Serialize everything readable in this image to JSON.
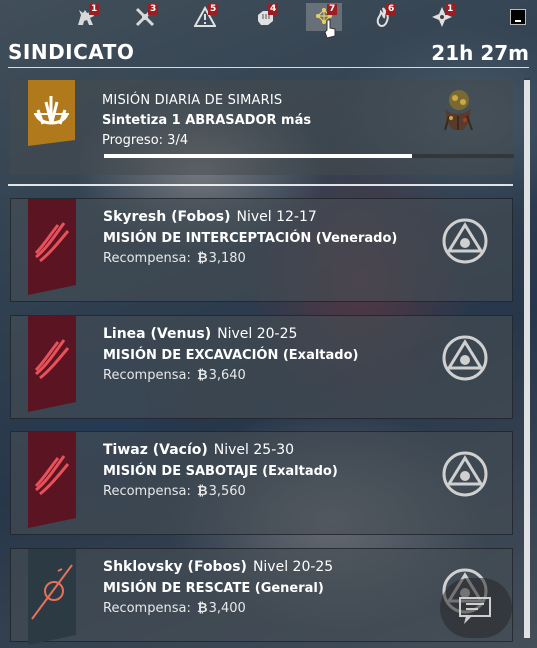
{
  "topbar": {
    "tabs": [
      {
        "icon": "wolf-icon",
        "badge": "1"
      },
      {
        "icon": "crossed-swords-icon",
        "badge": "3"
      },
      {
        "icon": "warning-icon",
        "badge": "5"
      },
      {
        "icon": "fist-icon",
        "badge": "4"
      },
      {
        "icon": "syndicate-tree-icon",
        "badge": "7",
        "active": true
      },
      {
        "icon": "flame-icon",
        "badge": "6"
      },
      {
        "icon": "shuriken-icon",
        "badge": "1"
      }
    ]
  },
  "header": {
    "title": "SINDICATO",
    "time": "21h 27m"
  },
  "daily": {
    "title": "MISIÓN DIARIA DE SIMARIS",
    "description": "Sintetiza 1 ABRASADOR más",
    "progress_text": "Progreso: 3/4",
    "progress_value": 0.75,
    "emblem_color": "#b07a1c",
    "emblem_icon": "simaris-icon",
    "target_icon": "abrasador-creature-icon"
  },
  "missions": [
    {
      "location": "Skyresh (Fobos)",
      "level": "Nivel 12-17",
      "type": "MISIÓN DE INTERCEPTACIÓN (Venerado)",
      "reward_label": "Recompensa:",
      "reward_value": "3,180",
      "emblem_icon": "red-veil-feather-icon",
      "rank_icon": "rank-triangle-icon"
    },
    {
      "location": "Linea (Venus)",
      "level": "Nivel 20-25",
      "type": "MISIÓN DE EXCAVACIÓN (Exaltado)",
      "reward_label": "Recompensa:",
      "reward_value": "3,640",
      "emblem_icon": "red-veil-feather-icon",
      "rank_icon": "rank-triangle-icon"
    },
    {
      "location": "Tiwaz (Vacío)",
      "level": "Nivel 25-30",
      "type": "MISIÓN DE SABOTAJE (Exaltado)",
      "reward_label": "Recompensa:",
      "reward_value": "3,560",
      "emblem_icon": "red-veil-feather-icon",
      "rank_icon": "rank-triangle-icon"
    },
    {
      "location": "Shklovsky (Fobos)",
      "level": "Nivel 20-25",
      "type": "MISIÓN DE RESCATE (General)",
      "reward_label": "Recompensa:",
      "reward_value": "3,400",
      "emblem_icon": "perrin-sequence-icon",
      "rank_icon": "rank-triangle-icon"
    }
  ],
  "colors": {
    "red_veil": "#5a1422",
    "red_veil_accent": "#e8505a",
    "perrin": "#2c3a44",
    "perrin_accent": "#e8705a",
    "badge": "#9a1f24"
  }
}
